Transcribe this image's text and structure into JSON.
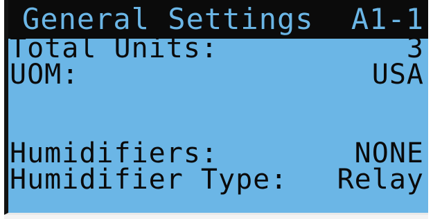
{
  "screen": {
    "title": "General Settings",
    "page_id": "A1-1"
  },
  "settings": [
    {
      "label": "Total Units:",
      "value": "3"
    },
    {
      "label": "UOM:",
      "value": "USA"
    },
    {
      "label": "Humidifiers:",
      "value": "NONE"
    },
    {
      "label": "Humidifier Type:",
      "value": "Relay"
    }
  ],
  "colors": {
    "lcd_background": "#6bb6e6",
    "text": "#0a0a0a",
    "title_bar": "#0b0b0b"
  }
}
